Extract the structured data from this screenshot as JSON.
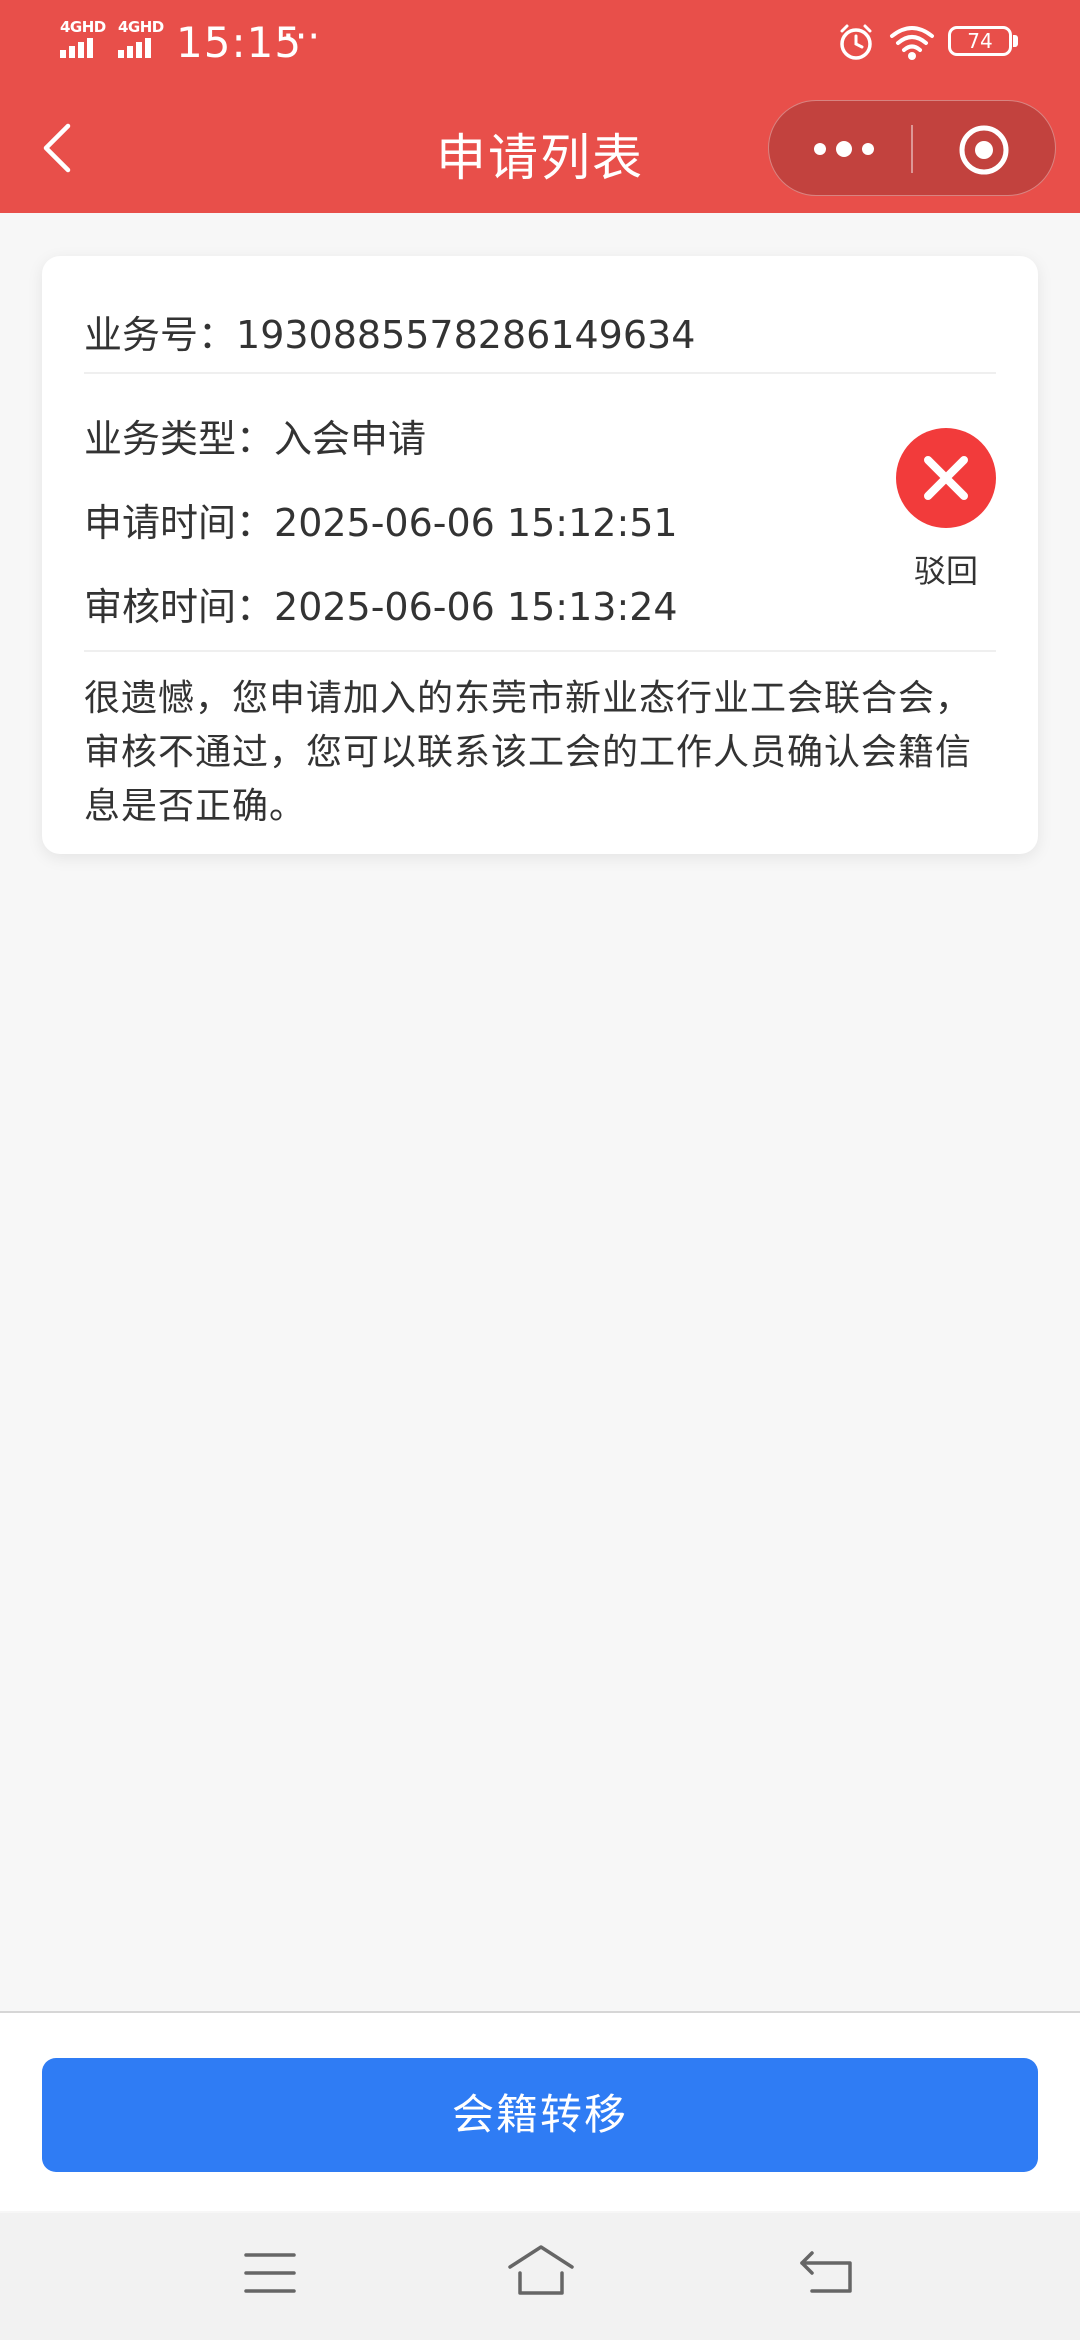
{
  "status_bar": {
    "network_1": "4GHD",
    "network_2": "4GHD",
    "time": "15:15",
    "more": "···",
    "battery": "74"
  },
  "header": {
    "title": "申请列表"
  },
  "card": {
    "biz_no_label": "业务号：",
    "biz_no": "1930885578286149634",
    "type_label": "业务类型：",
    "type_value": "入会申请",
    "apply_label": "申请时间：",
    "apply_value": "2025-06-06 15:12:51",
    "review_label": "审核时间：",
    "review_value": "2025-06-06 15:13:24",
    "status": "驳回",
    "status_color": "#f23b3b",
    "message": "很遗憾，您申请加入的东莞市新业态行业工会联合会，审核不通过，您可以联系该工会的工作人员确认会籍信息是否正确。"
  },
  "bottom": {
    "button_label": "会籍转移",
    "button_color": "#2f7cf4"
  },
  "colors": {
    "header": "#e84f4a",
    "background": "#f7f7f7"
  }
}
